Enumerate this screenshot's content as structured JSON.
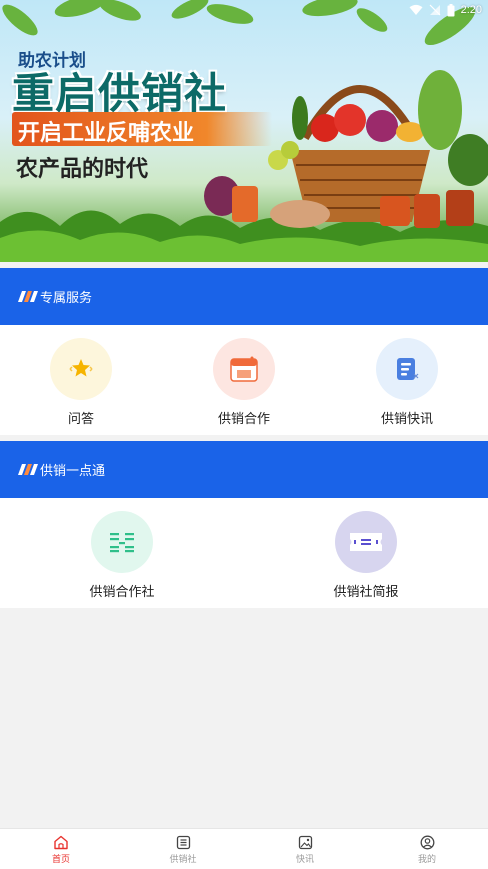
{
  "status_bar": {
    "time": "2:20"
  },
  "banner": {
    "tag": "助农计划",
    "title": "重启供销社",
    "slogan": "开启工业反哺农业",
    "subtitle": "农产品的时代"
  },
  "sections": [
    {
      "title": "专属服务",
      "items": [
        {
          "label": "问答",
          "icon": "star-badge-icon",
          "bg": "#fdf6dc",
          "color": "#f6b400"
        },
        {
          "label": "供销合作",
          "icon": "calendar-icon",
          "bg": "#fde6e1",
          "color": "#f06a3a"
        },
        {
          "label": "供销快讯",
          "icon": "news-list-icon",
          "bg": "#e5f0fc",
          "color": "#4a7fe0"
        }
      ]
    },
    {
      "title": "供销一点通",
      "items": [
        {
          "label": "供销合作社",
          "icon": "lines-icon",
          "bg": "#e1f7ee",
          "color": "#2fbf8a"
        },
        {
          "label": "供销社简报",
          "icon": "ticket-icon",
          "bg": "#d7d5ef",
          "color": "#5a4fd0"
        }
      ]
    }
  ],
  "nav": {
    "active_color": "#e8322e",
    "inactive_color": "#9a9a9a",
    "items": [
      {
        "label": "首页",
        "icon": "home-icon"
      },
      {
        "label": "供销社",
        "icon": "list-icon"
      },
      {
        "label": "快讯",
        "icon": "image-icon"
      },
      {
        "label": "我的",
        "icon": "user-icon"
      }
    ]
  }
}
